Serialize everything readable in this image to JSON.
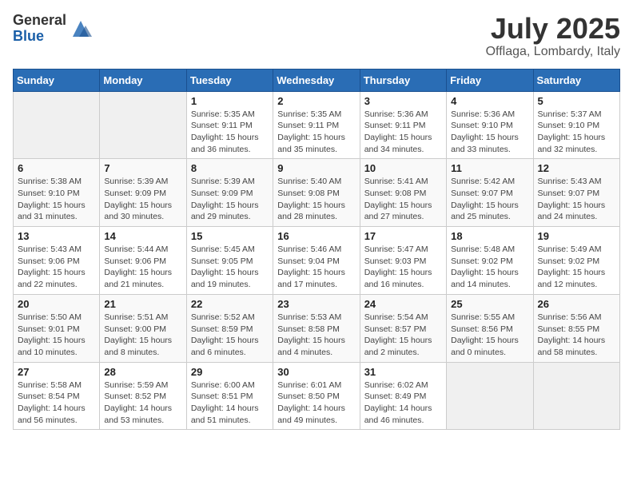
{
  "logo": {
    "general": "General",
    "blue": "Blue"
  },
  "title": "July 2025",
  "location": "Offlaga, Lombardy, Italy",
  "days_of_week": [
    "Sunday",
    "Monday",
    "Tuesday",
    "Wednesday",
    "Thursday",
    "Friday",
    "Saturday"
  ],
  "weeks": [
    [
      {
        "day": "",
        "info": ""
      },
      {
        "day": "",
        "info": ""
      },
      {
        "day": "1",
        "info": "Sunrise: 5:35 AM\nSunset: 9:11 PM\nDaylight: 15 hours and 36 minutes."
      },
      {
        "day": "2",
        "info": "Sunrise: 5:35 AM\nSunset: 9:11 PM\nDaylight: 15 hours and 35 minutes."
      },
      {
        "day": "3",
        "info": "Sunrise: 5:36 AM\nSunset: 9:11 PM\nDaylight: 15 hours and 34 minutes."
      },
      {
        "day": "4",
        "info": "Sunrise: 5:36 AM\nSunset: 9:10 PM\nDaylight: 15 hours and 33 minutes."
      },
      {
        "day": "5",
        "info": "Sunrise: 5:37 AM\nSunset: 9:10 PM\nDaylight: 15 hours and 32 minutes."
      }
    ],
    [
      {
        "day": "6",
        "info": "Sunrise: 5:38 AM\nSunset: 9:10 PM\nDaylight: 15 hours and 31 minutes."
      },
      {
        "day": "7",
        "info": "Sunrise: 5:39 AM\nSunset: 9:09 PM\nDaylight: 15 hours and 30 minutes."
      },
      {
        "day": "8",
        "info": "Sunrise: 5:39 AM\nSunset: 9:09 PM\nDaylight: 15 hours and 29 minutes."
      },
      {
        "day": "9",
        "info": "Sunrise: 5:40 AM\nSunset: 9:08 PM\nDaylight: 15 hours and 28 minutes."
      },
      {
        "day": "10",
        "info": "Sunrise: 5:41 AM\nSunset: 9:08 PM\nDaylight: 15 hours and 27 minutes."
      },
      {
        "day": "11",
        "info": "Sunrise: 5:42 AM\nSunset: 9:07 PM\nDaylight: 15 hours and 25 minutes."
      },
      {
        "day": "12",
        "info": "Sunrise: 5:43 AM\nSunset: 9:07 PM\nDaylight: 15 hours and 24 minutes."
      }
    ],
    [
      {
        "day": "13",
        "info": "Sunrise: 5:43 AM\nSunset: 9:06 PM\nDaylight: 15 hours and 22 minutes."
      },
      {
        "day": "14",
        "info": "Sunrise: 5:44 AM\nSunset: 9:06 PM\nDaylight: 15 hours and 21 minutes."
      },
      {
        "day": "15",
        "info": "Sunrise: 5:45 AM\nSunset: 9:05 PM\nDaylight: 15 hours and 19 minutes."
      },
      {
        "day": "16",
        "info": "Sunrise: 5:46 AM\nSunset: 9:04 PM\nDaylight: 15 hours and 17 minutes."
      },
      {
        "day": "17",
        "info": "Sunrise: 5:47 AM\nSunset: 9:03 PM\nDaylight: 15 hours and 16 minutes."
      },
      {
        "day": "18",
        "info": "Sunrise: 5:48 AM\nSunset: 9:02 PM\nDaylight: 15 hours and 14 minutes."
      },
      {
        "day": "19",
        "info": "Sunrise: 5:49 AM\nSunset: 9:02 PM\nDaylight: 15 hours and 12 minutes."
      }
    ],
    [
      {
        "day": "20",
        "info": "Sunrise: 5:50 AM\nSunset: 9:01 PM\nDaylight: 15 hours and 10 minutes."
      },
      {
        "day": "21",
        "info": "Sunrise: 5:51 AM\nSunset: 9:00 PM\nDaylight: 15 hours and 8 minutes."
      },
      {
        "day": "22",
        "info": "Sunrise: 5:52 AM\nSunset: 8:59 PM\nDaylight: 15 hours and 6 minutes."
      },
      {
        "day": "23",
        "info": "Sunrise: 5:53 AM\nSunset: 8:58 PM\nDaylight: 15 hours and 4 minutes."
      },
      {
        "day": "24",
        "info": "Sunrise: 5:54 AM\nSunset: 8:57 PM\nDaylight: 15 hours and 2 minutes."
      },
      {
        "day": "25",
        "info": "Sunrise: 5:55 AM\nSunset: 8:56 PM\nDaylight: 15 hours and 0 minutes."
      },
      {
        "day": "26",
        "info": "Sunrise: 5:56 AM\nSunset: 8:55 PM\nDaylight: 14 hours and 58 minutes."
      }
    ],
    [
      {
        "day": "27",
        "info": "Sunrise: 5:58 AM\nSunset: 8:54 PM\nDaylight: 14 hours and 56 minutes."
      },
      {
        "day": "28",
        "info": "Sunrise: 5:59 AM\nSunset: 8:52 PM\nDaylight: 14 hours and 53 minutes."
      },
      {
        "day": "29",
        "info": "Sunrise: 6:00 AM\nSunset: 8:51 PM\nDaylight: 14 hours and 51 minutes."
      },
      {
        "day": "30",
        "info": "Sunrise: 6:01 AM\nSunset: 8:50 PM\nDaylight: 14 hours and 49 minutes."
      },
      {
        "day": "31",
        "info": "Sunrise: 6:02 AM\nSunset: 8:49 PM\nDaylight: 14 hours and 46 minutes."
      },
      {
        "day": "",
        "info": ""
      },
      {
        "day": "",
        "info": ""
      }
    ]
  ]
}
